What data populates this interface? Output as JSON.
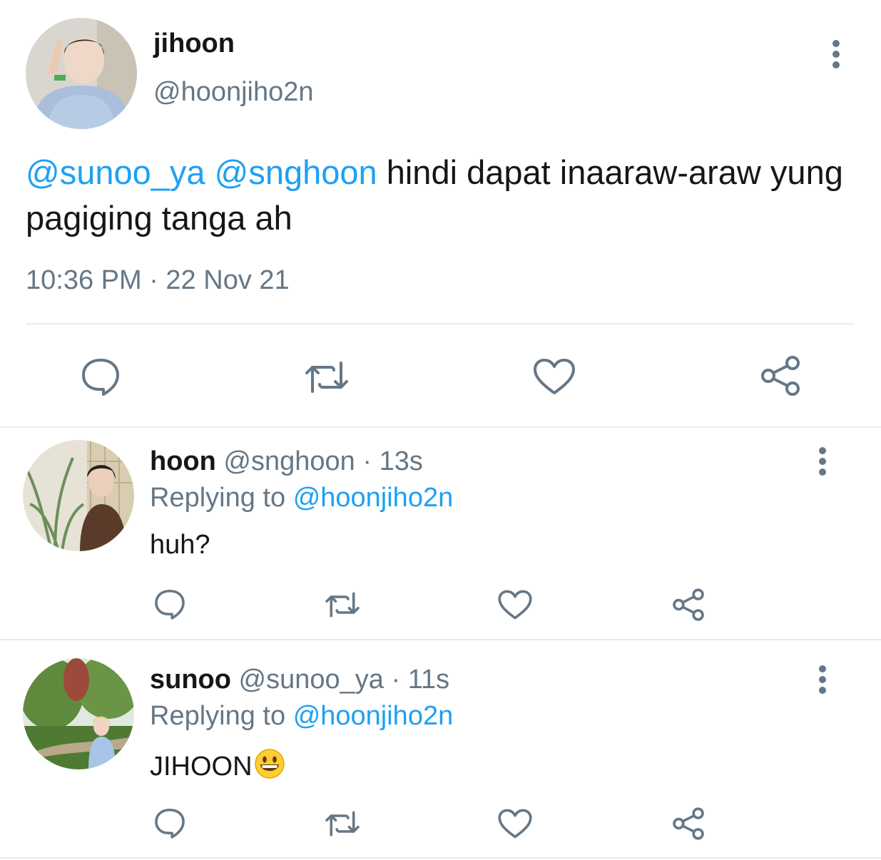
{
  "tweet": {
    "author_name": "jihoon",
    "author_handle": "@hoonjiho2n",
    "mention_1": "@sunoo_ya",
    "mention_2": "@snghoon",
    "text": "hindi dapat inaaraw-araw yung pagiging tanga ah",
    "timestamp": "10:36 PM · 22 Nov 21",
    "actions": {
      "reply_icon": "comment-icon",
      "retweet_icon": "retweet-icon",
      "like_icon": "heart-icon",
      "share_icon": "share-icon"
    }
  },
  "replies": [
    {
      "name": "hoon",
      "handle": "@snghoon",
      "time": "· 13s",
      "replying_prefix": "Replying to",
      "replying_to": "@hoonjiho2n",
      "text": "huh?"
    },
    {
      "name": "sunoo",
      "handle": "@sunoo_ya",
      "time": "· 11s",
      "replying_prefix": "Replying to",
      "replying_to": "@hoonjiho2n",
      "text": "JIHOON",
      "emoji": "grinning-face-emoji"
    }
  ],
  "colors": {
    "link": "#1da1f2",
    "muted": "#657786",
    "text": "#14171a",
    "divider": "#e6ecf0"
  }
}
